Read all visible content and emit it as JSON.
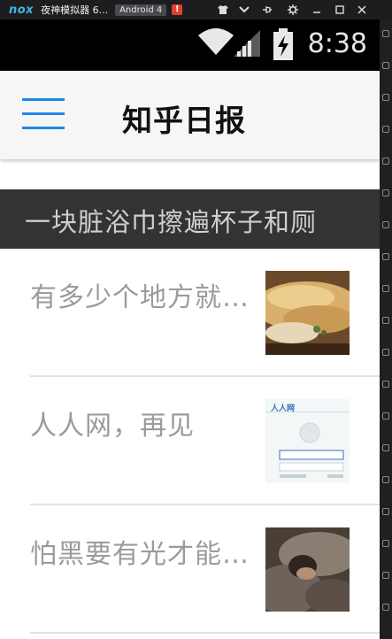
{
  "emulator": {
    "logo": "nox",
    "title": "夜神模拟器 6...",
    "android_badge": "Android 4",
    "alert_badge": "!"
  },
  "status_bar": {
    "time": "8:38"
  },
  "app_bar": {
    "title": "知乎日报",
    "accent_color": "#1e88e5"
  },
  "banner": {
    "text": "一块脏浴巾擦遍杯子和厕"
  },
  "stories": [
    {
      "title": "有多少个地方就…",
      "thumbnail": "food-photo"
    },
    {
      "title": "人人网，再见",
      "thumbnail": "renren-login-screenshot",
      "thumb_logo_text": "人人网"
    },
    {
      "title": "怕黑要有光才能…",
      "thumbnail": "sleeping-person-photo"
    }
  ]
}
